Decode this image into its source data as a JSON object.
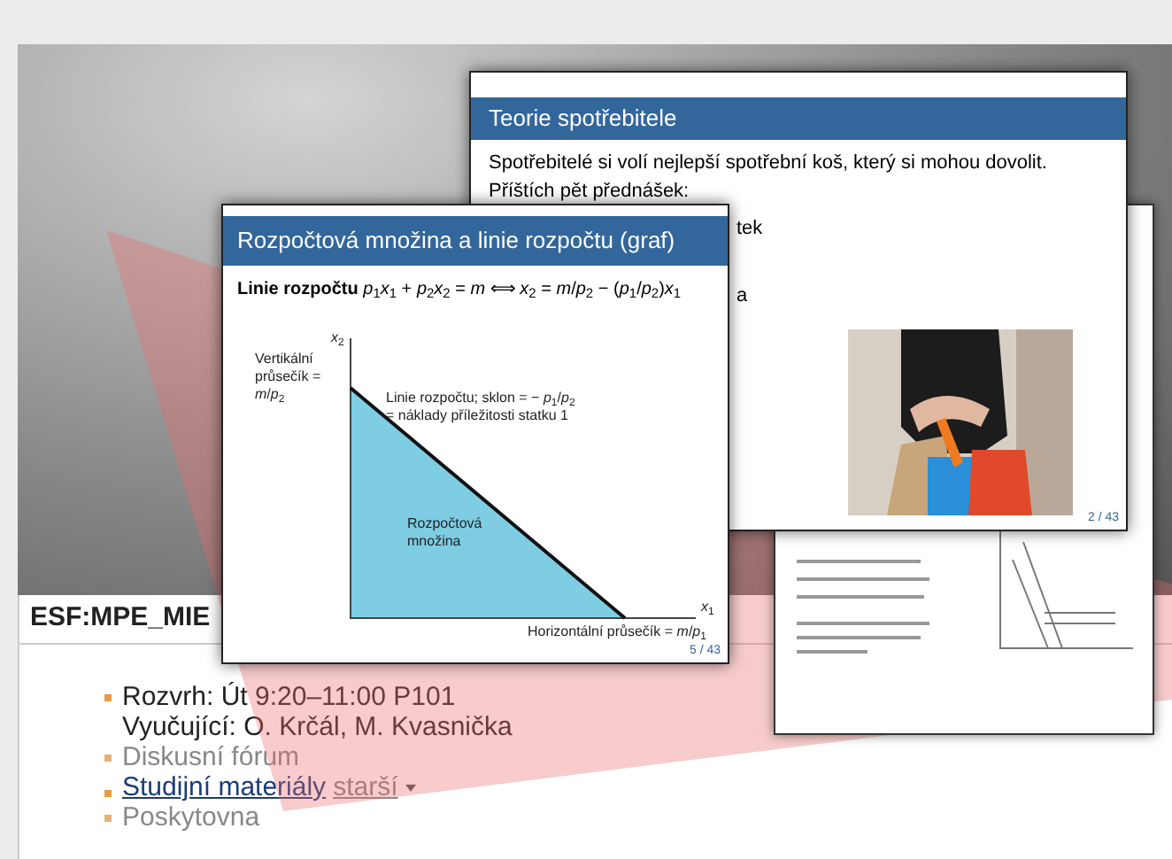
{
  "slides": [
    {
      "kind": "document"
    },
    {
      "kind": "text",
      "title": "Teorie spotřebitele",
      "lines": [
        "Spotřebitelé si volí nejlepší spotřební koš, který si mohou dovolit.",
        "Příštích pět přednášek:"
      ],
      "fragments": [
        "tek",
        "a"
      ],
      "picture": {
        "kind": "picture"
      },
      "page": "2 / 43"
    },
    {
      "kind": "graph",
      "title": "Rozpočtová množina a linie rozpočtu (graf)",
      "formula": "**Linie rozpočtu** *p*$_{1}$*x*$_{1}$ + *p*$_{2}$*x*$_{2}$ = *m* ⟺ *x*$_{2}$ = *m*/*p*$_{2}$ − (*p*$_{1}$/*p*$_{2}$)*x*$_{1}$",
      "y_axis": "*x*$_{2}$",
      "vertical_intercept": "Vertikální průsečík = *m*/*p*$_{2}$",
      "line_label": "Linie rozpočtu; sklon = − *p*$_{1}$/*p*$_{2}$ = náklady příležitosti statku 1",
      "region_label": "Rozpočtová množina",
      "horizontal_intercept": "Horizontální průsečík = *m*/*p*$_{1}$",
      "x_axis": "*x*$_{1}$",
      "page": "5 / 43"
    }
  ],
  "course": {
    "code": "ESF:MPE_MIE"
  },
  "course_items": [
    {
      "kind": "info",
      "lines": [
        "Rozvrh: Út 9:20–11:00 P101",
        "Vyučující: O. Krčál, M. Kvasnička"
      ]
    },
    {
      "kind": "muted",
      "text": "Diskusní fórum"
    },
    {
      "kind": "links",
      "link": "Studijní materiály",
      "secondary": "starší"
    },
    {
      "kind": "muted",
      "text": "Poskytovna"
    }
  ]
}
